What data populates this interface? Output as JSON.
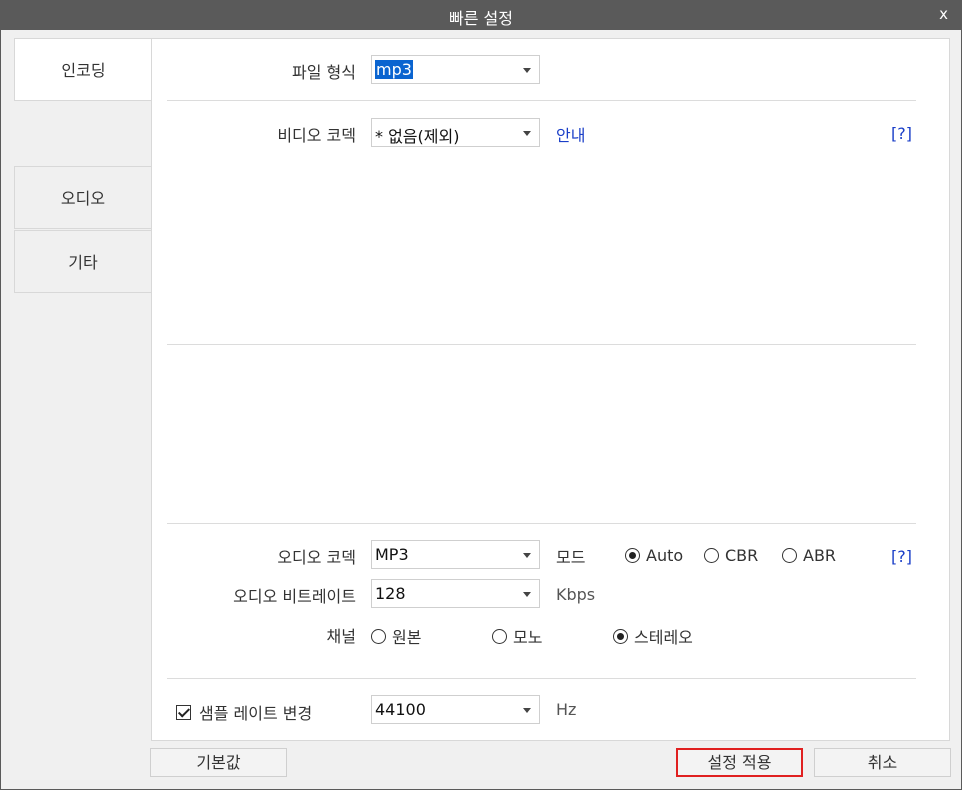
{
  "window": {
    "title": "빠른 설정",
    "close_label": "x"
  },
  "sidebar": {
    "tabs": [
      {
        "label": "인코딩"
      },
      {
        "label": "오디오"
      },
      {
        "label": "기타"
      }
    ]
  },
  "encoding": {
    "file_format": {
      "label": "파일 형식",
      "value": "mp3"
    },
    "video_codec": {
      "label": "비디오 코덱",
      "value": "* 없음(제외)",
      "guide_link": "안내",
      "help": "[?]"
    }
  },
  "audio": {
    "codec": {
      "label": "오디오 코덱",
      "value": "MP3"
    },
    "mode": {
      "label": "모드",
      "options": [
        {
          "label": "Auto",
          "selected": true
        },
        {
          "label": "CBR",
          "selected": false
        },
        {
          "label": "ABR",
          "selected": false
        }
      ],
      "help": "[?]"
    },
    "bitrate": {
      "label": "오디오 비트레이트",
      "value": "128",
      "unit": "Kbps"
    },
    "channel": {
      "label": "채널",
      "options": [
        {
          "label": "원본",
          "selected": false
        },
        {
          "label": "모노",
          "selected": false
        },
        {
          "label": "스테레오",
          "selected": true
        }
      ]
    },
    "sample_rate": {
      "checkbox_label": "샘플 레이트 변경",
      "checked": true,
      "value": "44100",
      "unit": "Hz"
    }
  },
  "footer": {
    "default_button": "기본값",
    "apply_button": "설정 적용",
    "cancel_button": "취소"
  }
}
